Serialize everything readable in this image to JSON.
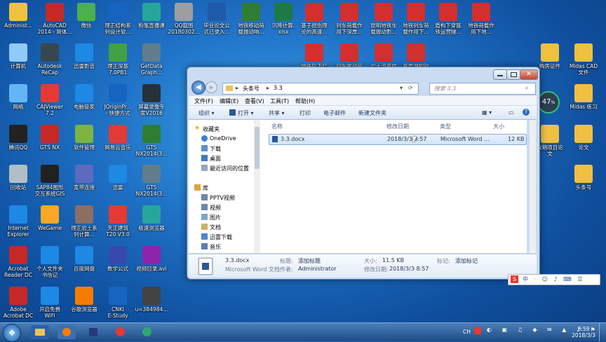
{
  "desktop": {
    "icons": [
      {
        "label": "Administ...",
        "color": "#f0c040"
      },
      {
        "label": "AutoCAD\n2014 - 简体...",
        "color": "#c62828"
      },
      {
        "label": "微信",
        "color": "#4caf50"
      },
      {
        "label": "理正结构系\n列设计软...",
        "color": "#1565c0"
      },
      {
        "label": "粉笔直播课",
        "color": "#26a69a"
      },
      {
        "label": "QQ截图\n20180302...",
        "color": "#9e9e9e"
      },
      {
        "label": "毕业论文公\n式已录入...",
        "color": "#1e5aa8"
      },
      {
        "label": "地铁移动荷\n载振动响...",
        "color": "#2e7d32"
      },
      {
        "label": "沉降计算.\nxlsx",
        "color": "#1d7a45"
      },
      {
        "label": "基于损伤理\n论的高速...",
        "color": "#d32f2f"
      },
      {
        "label": "列车荷载作\n用下深厚...",
        "color": "#d32f2f"
      },
      {
        "label": "昆明地铁车\n载振动影...",
        "color": "#d32f2f"
      },
      {
        "label": "地铁列车荷\n载作用下...",
        "color": "#d32f2f"
      },
      {
        "label": "盾构下穿既\n铁运营隧...",
        "color": "#d32f2f"
      },
      {
        "label": "地铁荷载作\n用下地...",
        "color": "#d32f2f"
      },
      {
        "label": "计算机",
        "color": "#90caf9"
      },
      {
        "label": "Autodesk\nReCap",
        "color": "#37474f"
      },
      {
        "label": "迅雷影音",
        "color": "#1e88e5"
      },
      {
        "label": "理正深基\n7.0PB1",
        "color": "#43a047"
      },
      {
        "label": "GetData\nGraph...",
        "color": "#607d8b"
      },
      {
        "label": "地铁轨下结",
        "color": "#d32f2f"
      },
      {
        "label": "列车振动荷",
        "color": "#d32f2f"
      },
      {
        "label": "岩土流变损",
        "color": "#d32f2f"
      },
      {
        "label": "高原湖相软",
        "color": "#d32f2f"
      },
      {
        "label": "网络",
        "color": "#64b5f6"
      },
      {
        "label": "CAJViewer\n7.2",
        "color": "#e53935"
      },
      {
        "label": "电脑管家",
        "color": "#1e88e5"
      },
      {
        "label": "JOriginPr...\n- 快捷方式",
        "color": "#1565c0"
      },
      {
        "label": "屏幕录像专\n家V2016",
        "color": "#263238"
      },
      {
        "label": "腾讯QQ",
        "color": "#222222"
      },
      {
        "label": "GTS NX",
        "color": "#c62828"
      },
      {
        "label": "软件管理",
        "color": "#7cb342"
      },
      {
        "label": "网易云音乐",
        "color": "#e53935"
      },
      {
        "label": "GTS\nNX2014(3...",
        "color": "#2e7d32"
      },
      {
        "label": "回收站",
        "color": "#b0bec5"
      },
      {
        "label": "SAP84图形\n交互系统GIS",
        "color": "#212121"
      },
      {
        "label": "宽带连接",
        "color": "#5c6bc0"
      },
      {
        "label": "迅雷",
        "color": "#1e88e5"
      },
      {
        "label": "GTS\nNX2014(3...",
        "color": "#607d8b"
      },
      {
        "label": "Internet\nExplorer",
        "color": "#1e88e5"
      },
      {
        "label": "WeGame",
        "color": "#f9a825"
      },
      {
        "label": "理正岩土系\n列计算...",
        "color": "#8d6e63"
      },
      {
        "label": "天正建筑\nT20 V3.0",
        "color": "#e53935"
      },
      {
        "label": "极速浏览器",
        "color": "#26a69a"
      },
      {
        "label": "Acrobat\nReader DC",
        "color": "#c62828"
      },
      {
        "label": "个人文件夹\n书信记",
        "color": "#1e88e5"
      },
      {
        "label": "百度网盘",
        "color": "#1e88e5"
      },
      {
        "label": "数学公式",
        "color": "#3949ab"
      },
      {
        "label": "视频目录.avi",
        "color": "#8e24aa"
      },
      {
        "label": "Adobe\nAcrobat DC",
        "color": "#c62828"
      },
      {
        "label": "开启免费\nWiFi",
        "color": "#1e88e5"
      },
      {
        "label": "谷歌浏览器",
        "color": "#f57c00"
      },
      {
        "label": "CNKI\nE-Study",
        "color": "#1565c0"
      },
      {
        "label": "u=384984...",
        "color": "#424242"
      },
      {
        "label": "购房证件",
        "color": "#f0c040"
      },
      {
        "label": "Midas CAD\n文件",
        "color": "#f0c040"
      },
      {
        "label": "Midas 练习",
        "color": "#f0c040"
      },
      {
        "label": "改期项目论\n文",
        "color": "#f0c040"
      },
      {
        "label": "论文",
        "color": "#f0c040"
      },
      {
        "label": "头条号",
        "color": "#f0c040"
      }
    ]
  },
  "explorer": {
    "breadcrumb": [
      "头条号",
      "3.3"
    ],
    "search_placeholder": "搜索 3.3",
    "menu": [
      "文件(F)",
      "编辑(E)",
      "查看(V)",
      "工具(T)",
      "帮助(H)"
    ],
    "toolbar": [
      "组织 ▾",
      "打开 ▾",
      "共享 ▾",
      "打印",
      "电子邮件",
      "新建文件夹"
    ],
    "nav": {
      "favorites_header": "收藏夹",
      "favorites": [
        "OneDrive",
        "下载",
        "桌面",
        "最近访问的位置"
      ],
      "library_header": "库",
      "libraries": [
        "PPTV视频",
        "视频",
        "图片",
        "文档",
        "迅雷下载",
        "音乐"
      ]
    },
    "columns": [
      "名称",
      "修改日期",
      "类型",
      "大小"
    ],
    "files": [
      {
        "name": "3.3.docx",
        "modified": "2018/3/3 8:57",
        "type": "Microsoft Word ...",
        "size": "12 KB"
      }
    ],
    "details": {
      "filename": "3.3.docx",
      "filetype": "Microsoft Word 文档",
      "tags_label": "标记:",
      "tags_value": "添加标记",
      "author_label": "作者:",
      "author_value": "Administrator",
      "size_label": "大小:",
      "size_value": "11.5 KB",
      "modified_label": "修改日期:",
      "modified_value": "2018/3/3 8:57",
      "title_label": "标题:",
      "title_value": "添加标题"
    }
  },
  "overlay": {
    "meter_value": "47",
    "meter_unit": "%"
  },
  "taskbar": {
    "time": "8:59",
    "date": "2018/3/3",
    "tray_lang": "CH"
  }
}
